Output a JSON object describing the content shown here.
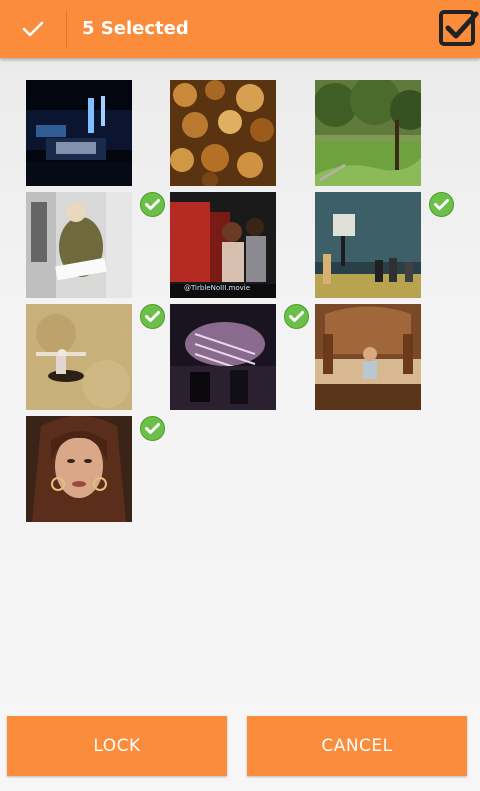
{
  "header": {
    "title": "5 Selected",
    "done_icon": "checkmark-icon",
    "select_all_icon": "checkbox-checked-icon",
    "accent_color": "#fb8c3c"
  },
  "grid": {
    "items": [
      {
        "label": "video-thumb-1",
        "selected": false
      },
      {
        "label": "video-thumb-2",
        "selected": false
      },
      {
        "label": "video-thumb-3",
        "selected": false
      },
      {
        "label": "video-thumb-4",
        "selected": true
      },
      {
        "label": "video-thumb-5",
        "selected": false
      },
      {
        "label": "video-thumb-6",
        "selected": true
      },
      {
        "label": "video-thumb-7",
        "selected": true
      },
      {
        "label": "video-thumb-8",
        "selected": true
      },
      {
        "label": "video-thumb-9",
        "selected": false
      },
      {
        "label": "video-thumb-10",
        "selected": true
      }
    ],
    "thumb5_caption": "@TirbleNoIII.movie",
    "selected_badge_color": "#6cc04a"
  },
  "footer": {
    "lock_label": "LOCK",
    "cancel_label": "CANCEL"
  }
}
